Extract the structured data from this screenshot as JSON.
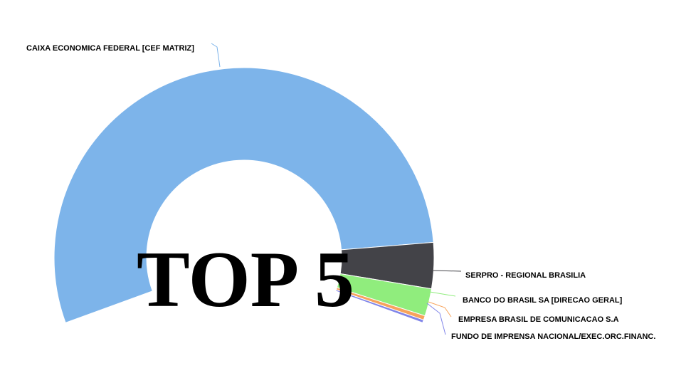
{
  "chart_data": {
    "type": "pie",
    "title": "",
    "overlay_text": "TOP 5",
    "slices": [
      {
        "label": "CAIXA ECONOMICA FEDERAL [CEF MATRIZ]",
        "value": 88.8,
        "color": "#7db4ea",
        "leader_color": "#7db4ea"
      },
      {
        "label": "SERPRO - REGIONAL BRASILIA",
        "value": 6.4,
        "color": "#434348",
        "leader_color": "#434348"
      },
      {
        "label": "BANCO DO BRASIL SA [DIRECAO GERAL]",
        "value": 3.8,
        "color": "#90ed7d",
        "leader_color": "#90ed7d"
      },
      {
        "label": "EMPRESA BRASIL DE COMUNICACAO S.A",
        "value": 0.6,
        "color": "#f7a35c",
        "leader_color": "#f7a35c"
      },
      {
        "label": "FUNDO DE IMPRENSA NACIONAL/EXEC.ORC.FINANC.",
        "value": 0.4,
        "color": "#8085e9",
        "leader_color": "#8085e9"
      }
    ],
    "legend": "none",
    "start_angle_deg": -110,
    "end_angle_deg": 110
  }
}
